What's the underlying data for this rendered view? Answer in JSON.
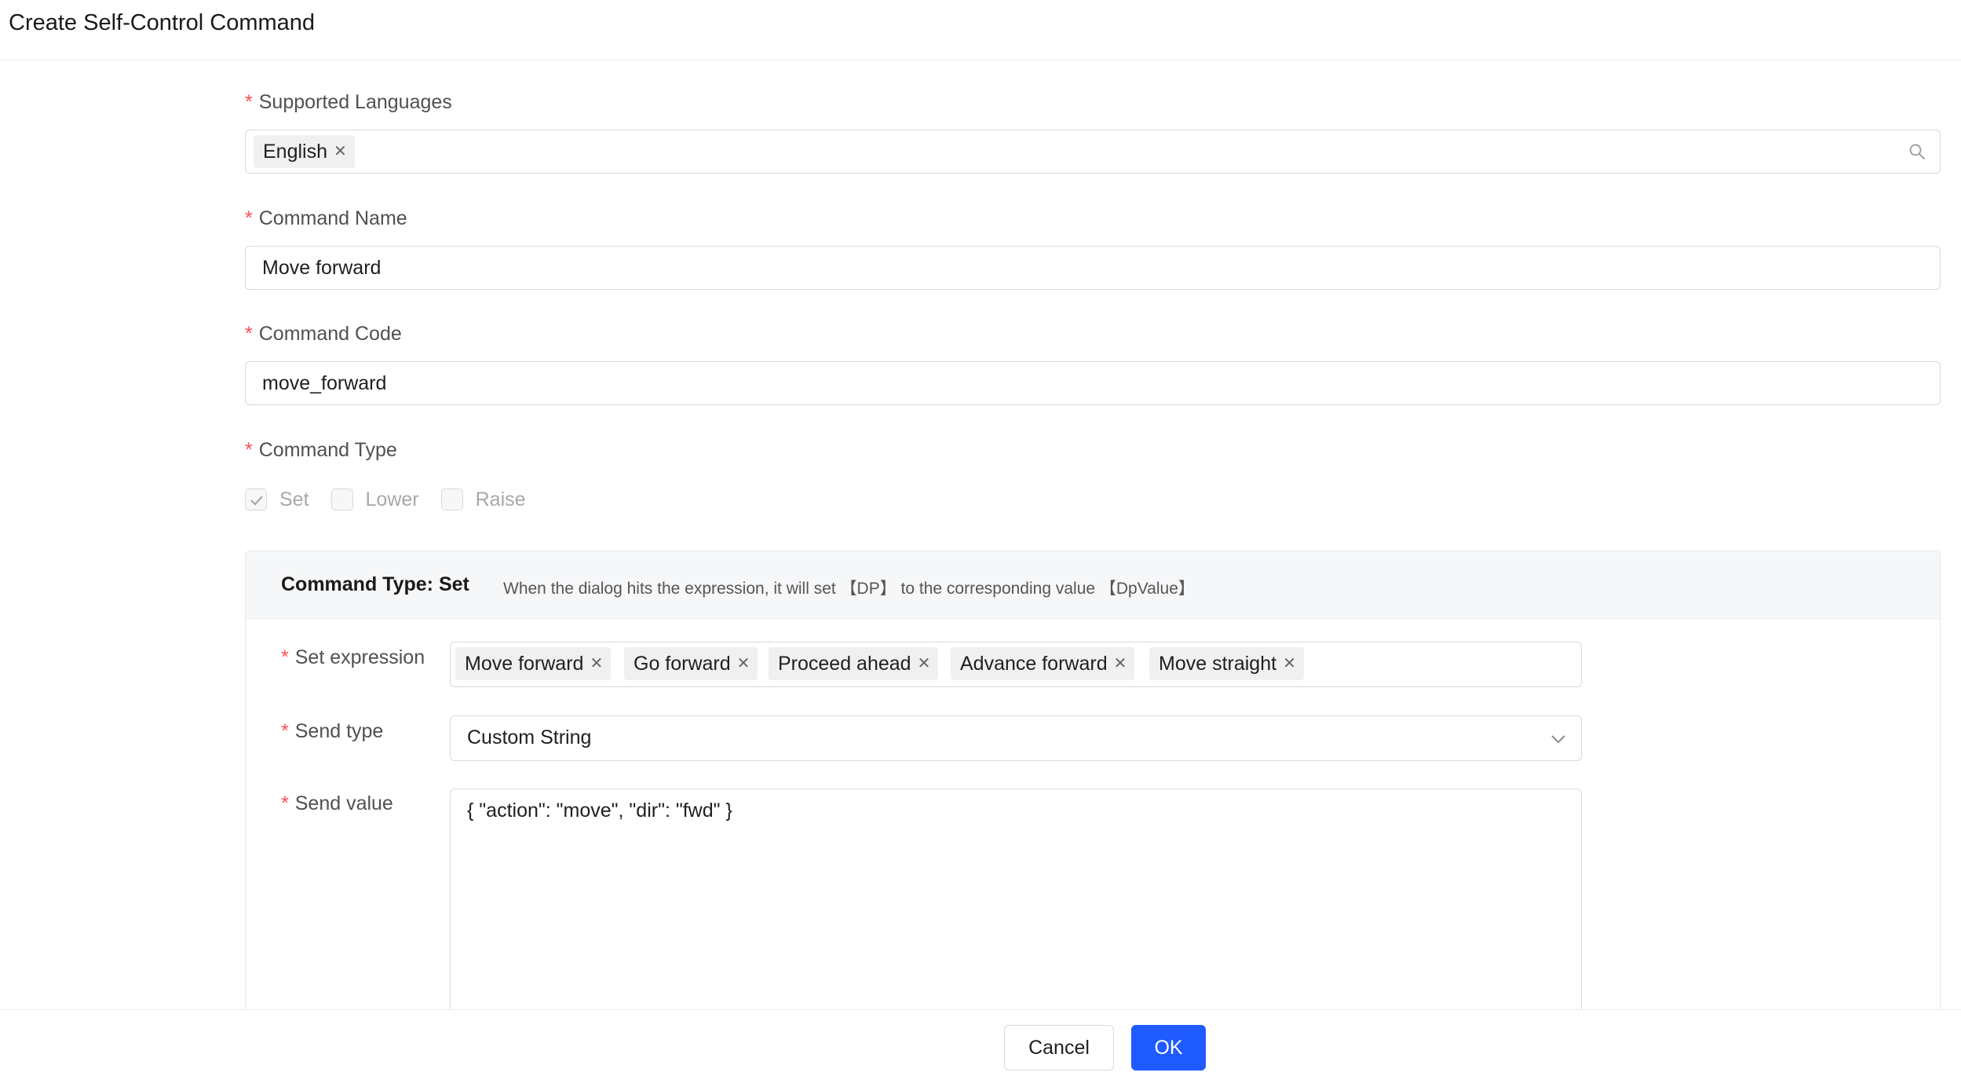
{
  "dialog": {
    "title": "Create Self-Control Command"
  },
  "form": {
    "required_mark": "*",
    "languages": {
      "label": "Supported Languages",
      "tags": [
        "English"
      ]
    },
    "command_name": {
      "label": "Command Name",
      "value": "Move forward"
    },
    "command_code": {
      "label": "Command Code",
      "value": "move_forward"
    },
    "command_type": {
      "label": "Command Type",
      "options": [
        {
          "label": "Set",
          "checked": true
        },
        {
          "label": "Lower",
          "checked": false
        },
        {
          "label": "Raise",
          "checked": false
        }
      ]
    }
  },
  "panel": {
    "title": "Command Type: Set",
    "description": "When the dialog hits the expression, it will set 【DP】 to the corresponding value 【DpValue】",
    "set_expression": {
      "label": "Set expression",
      "tags": [
        "Move forward",
        "Go forward",
        "Proceed ahead",
        "Advance forward",
        "Move straight"
      ]
    },
    "send_type": {
      "label": "Send type",
      "value": "Custom String"
    },
    "send_value": {
      "label": "Send value",
      "value": "{ \"action\": \"move\", \"dir\": \"fwd\" }"
    }
  },
  "footer": {
    "cancel_label": "Cancel",
    "ok_label": "OK"
  },
  "colors": {
    "primary": "#1f5bff",
    "required": "#ff4d4f"
  }
}
